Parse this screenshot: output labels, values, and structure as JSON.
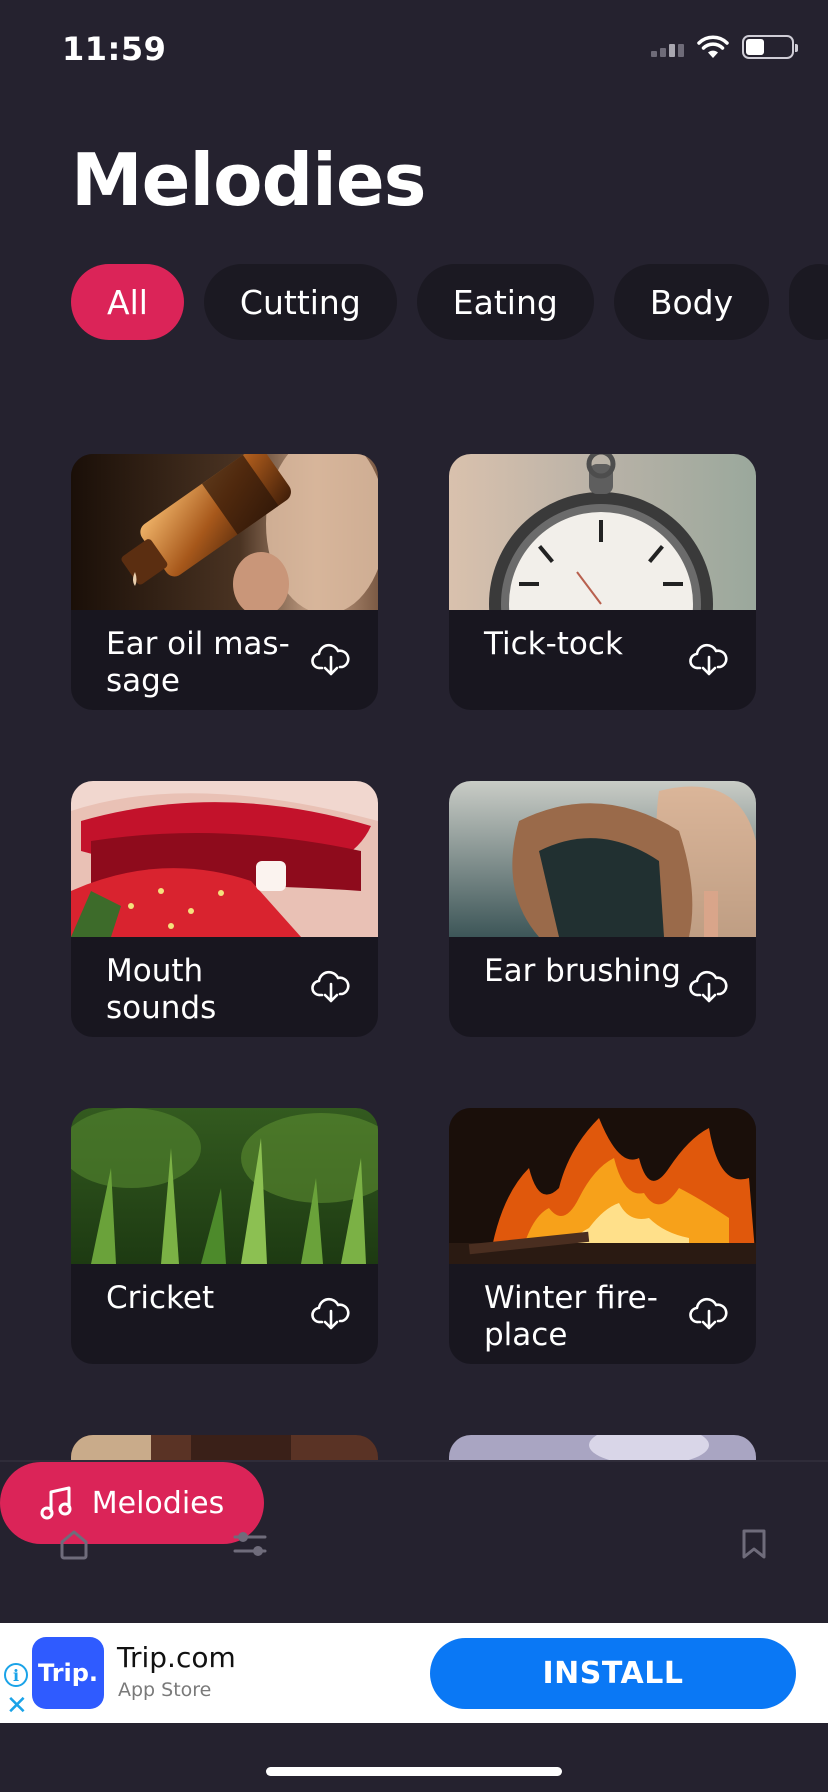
{
  "status_bar": {
    "time": "11:59"
  },
  "page": {
    "title": "Melodies"
  },
  "chips": [
    {
      "label": "All",
      "active": true
    },
    {
      "label": "Cutting",
      "active": false
    },
    {
      "label": "Eating",
      "active": false
    },
    {
      "label": "Body",
      "active": false
    }
  ],
  "cards": [
    {
      "title": "Ear oil mas-\nsage",
      "icon": "cloud-download-icon"
    },
    {
      "title": "Tick-tock",
      "icon": "cloud-download-icon"
    },
    {
      "title": "Mouth\nsounds",
      "icon": "cloud-download-icon"
    },
    {
      "title": "Ear brushing",
      "icon": "cloud-download-icon"
    },
    {
      "title": "Cricket",
      "icon": "cloud-download-icon"
    },
    {
      "title": "Winter fire-\nplace",
      "icon": "cloud-download-icon"
    }
  ],
  "bottom_nav": {
    "items": [
      {
        "name": "home",
        "icon": "home-icon",
        "active": false
      },
      {
        "name": "filters",
        "icon": "sliders-icon",
        "active": false
      },
      {
        "name": "melodies",
        "icon": "music-note-icon",
        "label": "Melodies",
        "active": true
      },
      {
        "name": "saved",
        "icon": "bookmark-icon",
        "active": false
      }
    ]
  },
  "ad": {
    "logo_text": "Trip.",
    "title": "Trip.com",
    "subtitle": "App Store",
    "cta": "INSTALL",
    "info_icon": "i",
    "close_icon": "✕"
  },
  "colors": {
    "background": "#25222f",
    "accent": "#db2458",
    "card": "#18161f",
    "install": "#0a78f5"
  }
}
